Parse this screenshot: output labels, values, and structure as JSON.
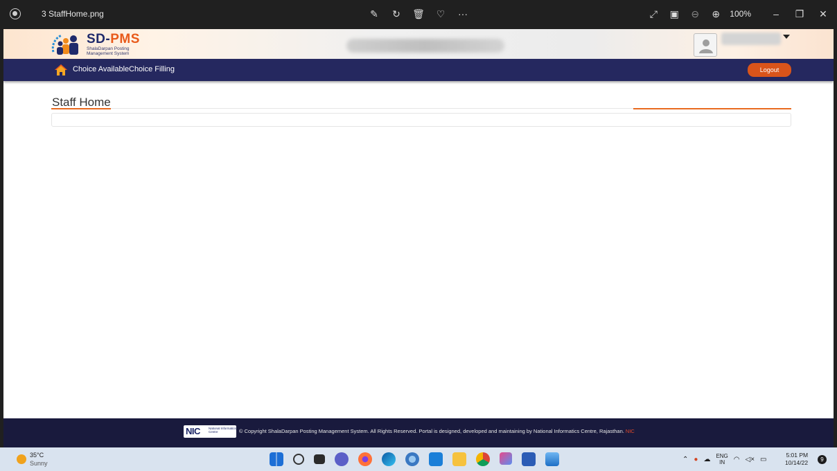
{
  "viewer": {
    "filename": "3 StaffHome.png",
    "zoom": "100%",
    "tools": [
      "edit-icon",
      "rotate-icon",
      "delete-icon",
      "favorite-icon",
      "more-icon"
    ],
    "more": "···"
  },
  "site": {
    "logo_title_main": "SD-",
    "logo_title_accent": "PMS",
    "logo_subtitle": "ShalaDarpan Posting Management System",
    "nav": {
      "choice_available": "Choice Available",
      "choice_filling": "Choice Filling",
      "logout": "Logout"
    },
    "page_title": "Staff Home",
    "footer": {
      "nic_logo": "NIC",
      "nic_logo_sub": "National Informatics Centre",
      "copyright": "© Copyright ShalaDarpan Posting Management System. All Rights Reserved. Portal is designed, developed and maintaining by National Informatics Centre, Rajasthan.",
      "nic_link": "NIC"
    }
  },
  "taskbar": {
    "temperature": "35°C",
    "weather": "Sunny",
    "lang_top": "ENG",
    "lang_bottom": "IN",
    "time": "5:01 PM",
    "date": "10/14/22",
    "notifications": "9"
  },
  "colors": {
    "nav_bg": "#25285f",
    "accent_orange": "#e86a1f",
    "logout_bg": "#d9541a",
    "footer_bg": "#191a3d"
  }
}
